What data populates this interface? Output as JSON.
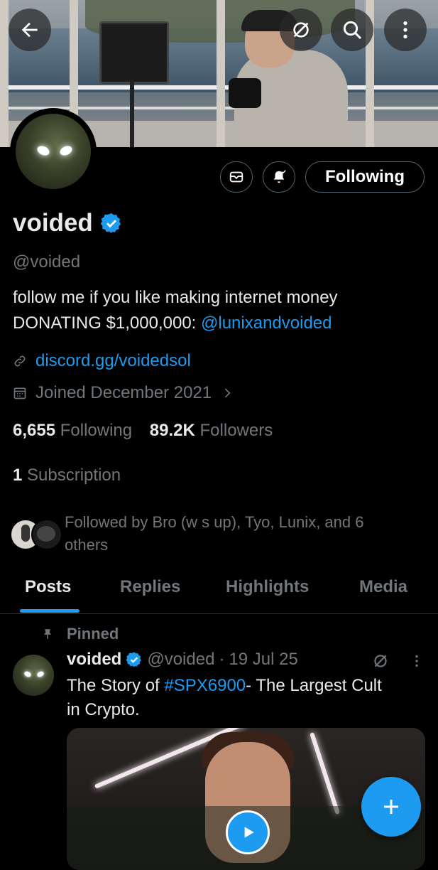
{
  "header": {
    "back_icon": "arrow-left-icon",
    "grok_icon": "grok-icon",
    "search_icon": "search-icon",
    "more_icon": "more-vertical-icon"
  },
  "profile": {
    "display_name": "voided",
    "handle": "@voided",
    "bio_line1": "follow me if you like making internet money",
    "bio_line2_prefix": "DONATING $1,000,000: ",
    "bio_mention": "@lunixandvoided",
    "website": "discord.gg/voidedsol",
    "joined": "Joined December 2021",
    "following_count": "6,655",
    "following_label": "Following",
    "followers_count": "89.2K",
    "followers_label": "Followers",
    "subscription_count": "1",
    "subscription_label": "Subscription",
    "followed_by_line1": "Followed by Bro (w s up), Tyo, Lunix, and 6",
    "followed_by_line2": "others",
    "follow_button_label": "Following"
  },
  "tabs": [
    {
      "label": "Posts",
      "active": true
    },
    {
      "label": "Replies",
      "active": false
    },
    {
      "label": "Highlights",
      "active": false
    },
    {
      "label": "Media",
      "active": false
    }
  ],
  "pinned_post": {
    "pinned_label": "Pinned",
    "author_name": "voided",
    "author_handle": "@voided",
    "separator": "·",
    "date": "19 Jul 25",
    "text_prefix": "The Story of ",
    "hashtag": "#SPX6900",
    "text_suffix_line1": "- The Largest Cult",
    "text_line2": "in Crypto."
  },
  "colors": {
    "accent": "#1d9bf0",
    "background": "#000000",
    "secondary_text": "#71767b",
    "divider": "#2f3336"
  }
}
